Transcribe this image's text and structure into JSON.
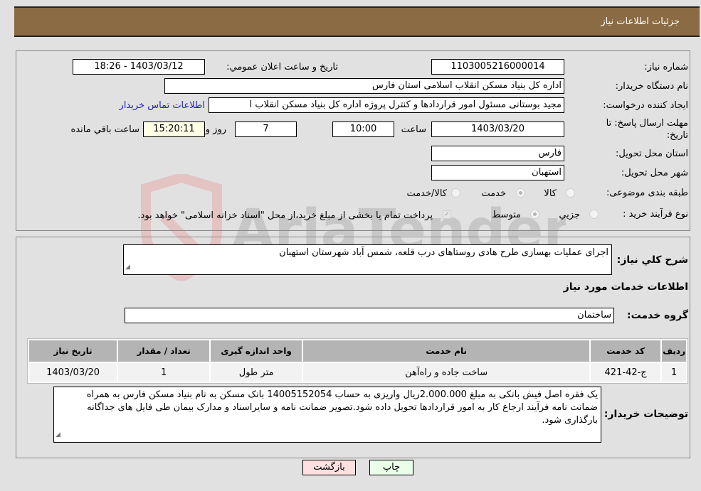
{
  "header": {
    "title": "جزئیات اطلاعات نیاز"
  },
  "details": {
    "need_number_label": "شماره نیاز:",
    "need_number": "1103005216000014",
    "announce_label": "تاریخ و ساعت اعلان عمومي:",
    "announce_value": "1403/03/12 - 18:26",
    "buyer_org_label": "نام دستگاه خریدار:",
    "buyer_org": "اداره کل بنیاد مسکن انقلاب اسلامی استان فارس",
    "creator_label": "ایجاد کننده درخواست:",
    "creator": "مجید بوستانی مسئول امور قراردادها و کنترل پروژه اداره کل بنیاد مسکن انقلاب ا",
    "contact_link": "اطلاعات تماس خریدار",
    "deadline_label_1": "مهلت ارسال پاسخ: تا",
    "deadline_label_2": "تاریخ:",
    "deadline_date": "1403/03/20",
    "time_label": "ساعت",
    "deadline_time": "10:00",
    "days": "7",
    "days_label": "روز و",
    "remaining_time": "15:20:11",
    "remaining_label": "ساعت باقي مانده",
    "province_label": "استان محل تحویل:",
    "province": "فارس",
    "city_label": "شهر محل تحویل:",
    "city": "استهبان",
    "category_label": "طبقه بندی موضوعی:",
    "category_options": [
      {
        "label": "کالا",
        "selected": false
      },
      {
        "label": "خدمت",
        "selected": true
      },
      {
        "label": "کالا/خدمت",
        "selected": false
      }
    ],
    "process_label": "نوع فرآیند خرید :",
    "process_options": [
      {
        "label": "جزيي",
        "selected": false
      },
      {
        "label": "متوسط",
        "selected": true
      }
    ],
    "treasury_checked": true,
    "treasury_text": "پرداخت تمام یا بخشی از مبلغ خرید،از محل \"اسناد خزانه اسلامی\" خواهد بود."
  },
  "summary": {
    "label": "شرح کلي نیاز:",
    "value": "اجرای عملیات بهسازی طرح هادی روستاهای درب قلعه، شمس آباد شهرستان استهبان"
  },
  "services": {
    "section_title": "اطلاعات خدمات مورد نیاز",
    "group_label": "گروه خدمت:",
    "group_value": "ساختمان",
    "columns": [
      "ردیف",
      "کد خدمت",
      "نام خدمت",
      "واحد اندازه گیری",
      "تعداد / مقدار",
      "تاریخ نیاز"
    ],
    "rows": [
      [
        "1",
        "ج-42-421",
        "ساخت جاده و راه‌آهن",
        "متر طول",
        "1",
        "1403/03/20"
      ]
    ]
  },
  "buyer_notes": {
    "label": "توضیحات خریدار:",
    "value": "یک فقره اصل فیش بانکی به مبلغ 2.000.000ریال واریزی به حساب 14005152054 بانک مسکن به نام بنیاد مسکن فارس به همراه ضمانت نامه فرآیند ارجاع کار به امور قراردادها تحویل داده شود.تصویر ضمانت نامه و سایراسناد و مدارک بیمان طی فایل های جداگانه بارگذاری شود."
  },
  "buttons": {
    "print": "چاپ",
    "back": "بازگشت"
  },
  "watermark": {
    "text": "AriaTender.neT"
  },
  "colors": {
    "header_bg": "#8b6b43",
    "link": "#2020d0",
    "print_bg": "#eaffea",
    "back_bg": "#ffe0e0",
    "remaining_bg": "#ffffe6"
  }
}
